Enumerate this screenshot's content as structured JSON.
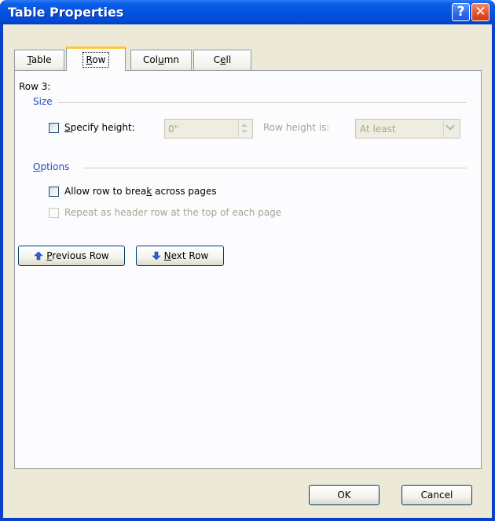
{
  "window": {
    "title": "Table Properties",
    "help_glyph": "?",
    "close_glyph": "✕"
  },
  "tabs": [
    {
      "label_pre": "",
      "label_u": "T",
      "label_post": "able"
    },
    {
      "label_pre": "",
      "label_u": "R",
      "label_post": "ow"
    },
    {
      "label_pre": "Col",
      "label_u": "u",
      "label_post": "mn"
    },
    {
      "label_pre": "C",
      "label_u": "e",
      "label_post": "ll"
    }
  ],
  "row_panel": {
    "row_label": "Row 3:",
    "size_group": "Size",
    "specify_height": {
      "pre": "",
      "u": "S",
      "post": "pecify height:",
      "checked": false
    },
    "height_value": "0\"",
    "row_height_is_label": "Row height is:",
    "row_height_select": "At least",
    "options_group_pre": "",
    "options_group_u": "O",
    "options_group_post": "ptions",
    "allow_break": {
      "pre": "Allow row to brea",
      "u": "k",
      "post": " across pages",
      "checked": false
    },
    "repeat_header": {
      "text": "Repeat as header row at the top of each page",
      "checked": false,
      "disabled": true
    },
    "previous_row": {
      "pre": "",
      "u": "P",
      "post": "revious Row"
    },
    "next_row": {
      "pre": "",
      "u": "N",
      "post": "ext Row"
    }
  },
  "footer": {
    "ok_label": "OK",
    "cancel_label": "Cancel"
  },
  "colors": {
    "titlebar": "#0553e1",
    "dialog_bg": "#ece9d8",
    "group_title": "#1a4cc4",
    "active_tab_accent": "#ffc83c"
  }
}
